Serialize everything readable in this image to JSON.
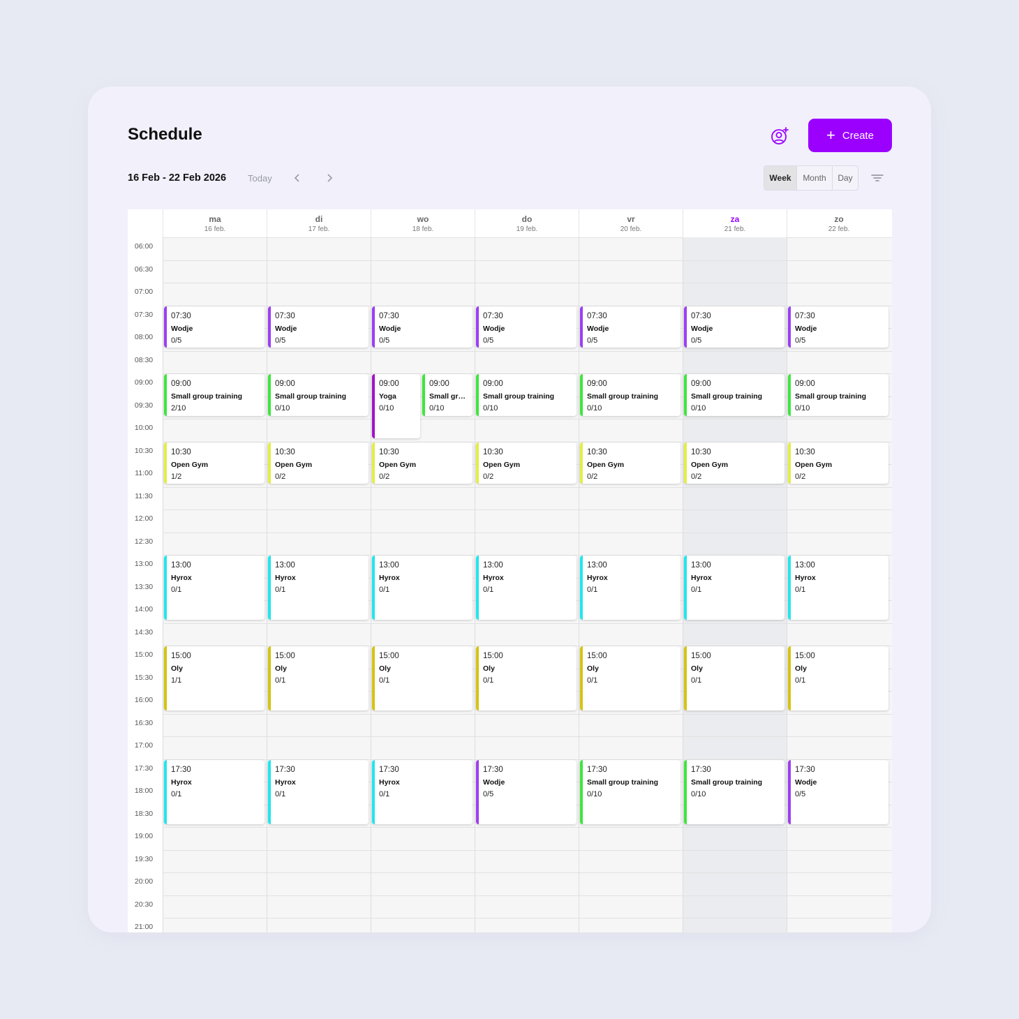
{
  "header": {
    "title": "Schedule",
    "create_label": "Create",
    "create_plus": "+"
  },
  "toolbar": {
    "date_range": "16 Feb - 22 Feb 2026",
    "today_label": "Today",
    "views": [
      "Week",
      "Month",
      "Day"
    ],
    "active_view": "Week"
  },
  "colors": {
    "accent": "#9b00ff",
    "wodje": "#9b3ff0",
    "small_group": "#3ee63e",
    "yoga": "#a312c8",
    "open_gym": "#e3ee45",
    "hyrox": "#22e6ee",
    "oly": "#d4c40f"
  },
  "days": [
    {
      "name": "ma",
      "date": "16 feb."
    },
    {
      "name": "di",
      "date": "17 feb."
    },
    {
      "name": "wo",
      "date": "18 feb."
    },
    {
      "name": "do",
      "date": "19 feb."
    },
    {
      "name": "vr",
      "date": "20 feb."
    },
    {
      "name": "za",
      "date": "21 feb.",
      "today": true
    },
    {
      "name": "zo",
      "date": "22 feb."
    }
  ],
  "time_slots": [
    "06:00",
    "06:30",
    "07:00",
    "07:30",
    "08:00",
    "08:30",
    "09:00",
    "09:30",
    "10:00",
    "10:30",
    "11:00",
    "11:30",
    "12:00",
    "12:30",
    "13:00",
    "13:30",
    "14:00",
    "14:30",
    "15:00",
    "15:30",
    "16:00",
    "16:30",
    "17:00",
    "17:30",
    "18:00",
    "18:30",
    "19:00",
    "19:30",
    "20:00",
    "20:30",
    "21:00"
  ],
  "events": [
    {
      "day": 0,
      "start": "07:30",
      "end": "08:25",
      "name": "Wodje",
      "capacity": "0/5",
      "color": "wodje"
    },
    {
      "day": 1,
      "start": "07:30",
      "end": "08:25",
      "name": "Wodje",
      "capacity": "0/5",
      "color": "wodje"
    },
    {
      "day": 2,
      "start": "07:30",
      "end": "08:25",
      "name": "Wodje",
      "capacity": "0/5",
      "color": "wodje"
    },
    {
      "day": 3,
      "start": "07:30",
      "end": "08:25",
      "name": "Wodje",
      "capacity": "0/5",
      "color": "wodje"
    },
    {
      "day": 4,
      "start": "07:30",
      "end": "08:25",
      "name": "Wodje",
      "capacity": "0/5",
      "color": "wodje"
    },
    {
      "day": 5,
      "start": "07:30",
      "end": "08:25",
      "name": "Wodje",
      "capacity": "0/5",
      "color": "wodje"
    },
    {
      "day": 6,
      "start": "07:30",
      "end": "08:25",
      "name": "Wodje",
      "capacity": "0/5",
      "color": "wodje"
    },
    {
      "day": 0,
      "start": "09:00",
      "end": "09:55",
      "name": "Small group training",
      "capacity": "2/10",
      "color": "small_group"
    },
    {
      "day": 1,
      "start": "09:00",
      "end": "09:55",
      "name": "Small group training",
      "capacity": "0/10",
      "color": "small_group"
    },
    {
      "day": 2,
      "start": "09:00",
      "end": "10:25",
      "name": "Yoga",
      "capacity": "0/10",
      "color": "yoga",
      "split": "left"
    },
    {
      "day": 2,
      "start": "09:00",
      "end": "09:55",
      "name": "Small group training",
      "capacity": "0/10",
      "color": "small_group",
      "split": "right"
    },
    {
      "day": 3,
      "start": "09:00",
      "end": "09:55",
      "name": "Small group training",
      "capacity": "0/10",
      "color": "small_group"
    },
    {
      "day": 4,
      "start": "09:00",
      "end": "09:55",
      "name": "Small group training",
      "capacity": "0/10",
      "color": "small_group"
    },
    {
      "day": 5,
      "start": "09:00",
      "end": "09:55",
      "name": "Small group training",
      "capacity": "0/10",
      "color": "small_group"
    },
    {
      "day": 6,
      "start": "09:00",
      "end": "09:55",
      "name": "Small group training",
      "capacity": "0/10",
      "color": "small_group"
    },
    {
      "day": 0,
      "start": "10:30",
      "end": "11:25",
      "name": "Open Gym",
      "capacity": "1/2",
      "color": "open_gym"
    },
    {
      "day": 1,
      "start": "10:30",
      "end": "11:25",
      "name": "Open Gym",
      "capacity": "0/2",
      "color": "open_gym"
    },
    {
      "day": 2,
      "start": "10:30",
      "end": "11:25",
      "name": "Open Gym",
      "capacity": "0/2",
      "color": "open_gym"
    },
    {
      "day": 3,
      "start": "10:30",
      "end": "11:25",
      "name": "Open Gym",
      "capacity": "0/2",
      "color": "open_gym"
    },
    {
      "day": 4,
      "start": "10:30",
      "end": "11:25",
      "name": "Open Gym",
      "capacity": "0/2",
      "color": "open_gym"
    },
    {
      "day": 5,
      "start": "10:30",
      "end": "11:25",
      "name": "Open Gym",
      "capacity": "0/2",
      "color": "open_gym"
    },
    {
      "day": 6,
      "start": "10:30",
      "end": "11:25",
      "name": "Open Gym",
      "capacity": "0/2",
      "color": "open_gym"
    },
    {
      "day": 0,
      "start": "13:00",
      "end": "14:25",
      "name": "Hyrox",
      "capacity": "0/1",
      "color": "hyrox"
    },
    {
      "day": 1,
      "start": "13:00",
      "end": "14:25",
      "name": "Hyrox",
      "capacity": "0/1",
      "color": "hyrox"
    },
    {
      "day": 2,
      "start": "13:00",
      "end": "14:25",
      "name": "Hyrox",
      "capacity": "0/1",
      "color": "hyrox"
    },
    {
      "day": 3,
      "start": "13:00",
      "end": "14:25",
      "name": "Hyrox",
      "capacity": "0/1",
      "color": "hyrox"
    },
    {
      "day": 4,
      "start": "13:00",
      "end": "14:25",
      "name": "Hyrox",
      "capacity": "0/1",
      "color": "hyrox"
    },
    {
      "day": 5,
      "start": "13:00",
      "end": "14:25",
      "name": "Hyrox",
      "capacity": "0/1",
      "color": "hyrox"
    },
    {
      "day": 6,
      "start": "13:00",
      "end": "14:25",
      "name": "Hyrox",
      "capacity": "0/1",
      "color": "hyrox"
    },
    {
      "day": 0,
      "start": "15:00",
      "end": "16:25",
      "name": "Oly",
      "capacity": "1/1",
      "color": "oly"
    },
    {
      "day": 1,
      "start": "15:00",
      "end": "16:25",
      "name": "Oly",
      "capacity": "0/1",
      "color": "oly"
    },
    {
      "day": 2,
      "start": "15:00",
      "end": "16:25",
      "name": "Oly",
      "capacity": "0/1",
      "color": "oly"
    },
    {
      "day": 3,
      "start": "15:00",
      "end": "16:25",
      "name": "Oly",
      "capacity": "0/1",
      "color": "oly"
    },
    {
      "day": 4,
      "start": "15:00",
      "end": "16:25",
      "name": "Oly",
      "capacity": "0/1",
      "color": "oly"
    },
    {
      "day": 5,
      "start": "15:00",
      "end": "16:25",
      "name": "Oly",
      "capacity": "0/1",
      "color": "oly"
    },
    {
      "day": 6,
      "start": "15:00",
      "end": "16:25",
      "name": "Oly",
      "capacity": "0/1",
      "color": "oly"
    },
    {
      "day": 0,
      "start": "17:30",
      "end": "18:55",
      "name": "Hyrox",
      "capacity": "0/1",
      "color": "hyrox"
    },
    {
      "day": 1,
      "start": "17:30",
      "end": "18:55",
      "name": "Hyrox",
      "capacity": "0/1",
      "color": "hyrox"
    },
    {
      "day": 2,
      "start": "17:30",
      "end": "18:55",
      "name": "Hyrox",
      "capacity": "0/1",
      "color": "hyrox"
    },
    {
      "day": 3,
      "start": "17:30",
      "end": "18:55",
      "name": "Wodje",
      "capacity": "0/5",
      "color": "wodje"
    },
    {
      "day": 4,
      "start": "17:30",
      "end": "18:55",
      "name": "Small group training",
      "capacity": "0/10",
      "color": "small_group"
    },
    {
      "day": 5,
      "start": "17:30",
      "end": "18:55",
      "name": "Small group training",
      "capacity": "0/10",
      "color": "small_group"
    },
    {
      "day": 6,
      "start": "17:30",
      "end": "18:55",
      "name": "Wodje",
      "capacity": "0/5",
      "color": "wodje"
    }
  ]
}
